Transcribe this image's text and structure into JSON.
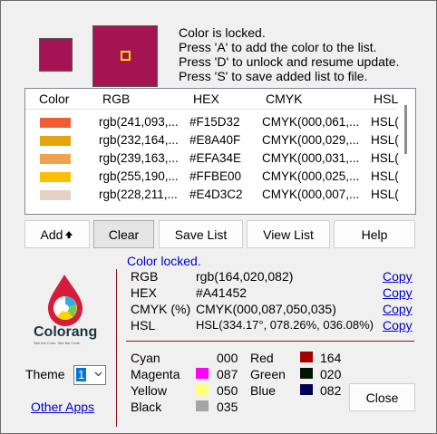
{
  "current": {
    "color": "#A41452",
    "status": "Color locked.",
    "rgb_label": "RGB",
    "rgb": "rgb(164,020,082)",
    "hex_label": "HEX",
    "hex": "#A41452",
    "cmyk_label": "CMYK (%)",
    "cmyk": "CMYK(000,087,050,035)",
    "hsl_label": "HSL",
    "hsl": "HSL(334.17°, 078.26%, 036.08%)",
    "copy_label": "Copy"
  },
  "instructions": [
    "Color is locked.",
    "Press 'A' to add the color to the list.",
    "Press 'D' to unlock and resume update.",
    "Press 'S' to save added list to file."
  ],
  "list": {
    "headers": {
      "color": "Color",
      "rgb": "RGB",
      "hex": "HEX",
      "cmyk": "CMYK",
      "hsl": "HSL"
    },
    "rows": [
      {
        "swatch": "#F15D32",
        "rgb": "rgb(241,093,...",
        "hex": "#F15D32",
        "cmyk": "CMYK(000,061,...",
        "hsl": "HSL(("
      },
      {
        "swatch": "#E8A40F",
        "rgb": "rgb(232,164,...",
        "hex": "#E8A40F",
        "cmyk": "CMYK(000,029,...",
        "hsl": "HSL(("
      },
      {
        "swatch": "#EFA34E",
        "rgb": "rgb(239,163,...",
        "hex": "#EFA34E",
        "cmyk": "CMYK(000,031,...",
        "hsl": "HSL(("
      },
      {
        "swatch": "#FFBE00",
        "rgb": "rgb(255,190,...",
        "hex": "#FFBE00",
        "cmyk": "CMYK(000,025,...",
        "hsl": "HSL(("
      },
      {
        "swatch": "#E4D3C2",
        "rgb": "rgb(228,211,...",
        "hex": "#E4D3C2",
        "cmyk": "CMYK(000,007,...",
        "hsl": "HSL(("
      }
    ]
  },
  "buttons": {
    "add": "Add",
    "clear": "Clear",
    "save_list": "Save List",
    "view_list": "View List",
    "help": "Help",
    "close": "Close"
  },
  "logo": {
    "name": "Colorang",
    "tagline": "See the Color. See the Code."
  },
  "theme": {
    "label": "Theme",
    "value": "1"
  },
  "other_apps": "Other Apps",
  "components": {
    "cyan": {
      "label": "Cyan",
      "value": "000"
    },
    "magenta": {
      "label": "Magenta",
      "value": "087",
      "color": "#FF00FF"
    },
    "yellow": {
      "label": "Yellow",
      "value": "050",
      "color": "#FFFF80"
    },
    "black": {
      "label": "Black",
      "value": "035",
      "color": "#A5A5A5"
    },
    "red": {
      "label": "Red",
      "value": "164",
      "color": "#A40000"
    },
    "green": {
      "label": "Green",
      "value": "020",
      "color": "#001400"
    },
    "blue": {
      "label": "Blue",
      "value": "082",
      "color": "#000052"
    }
  }
}
